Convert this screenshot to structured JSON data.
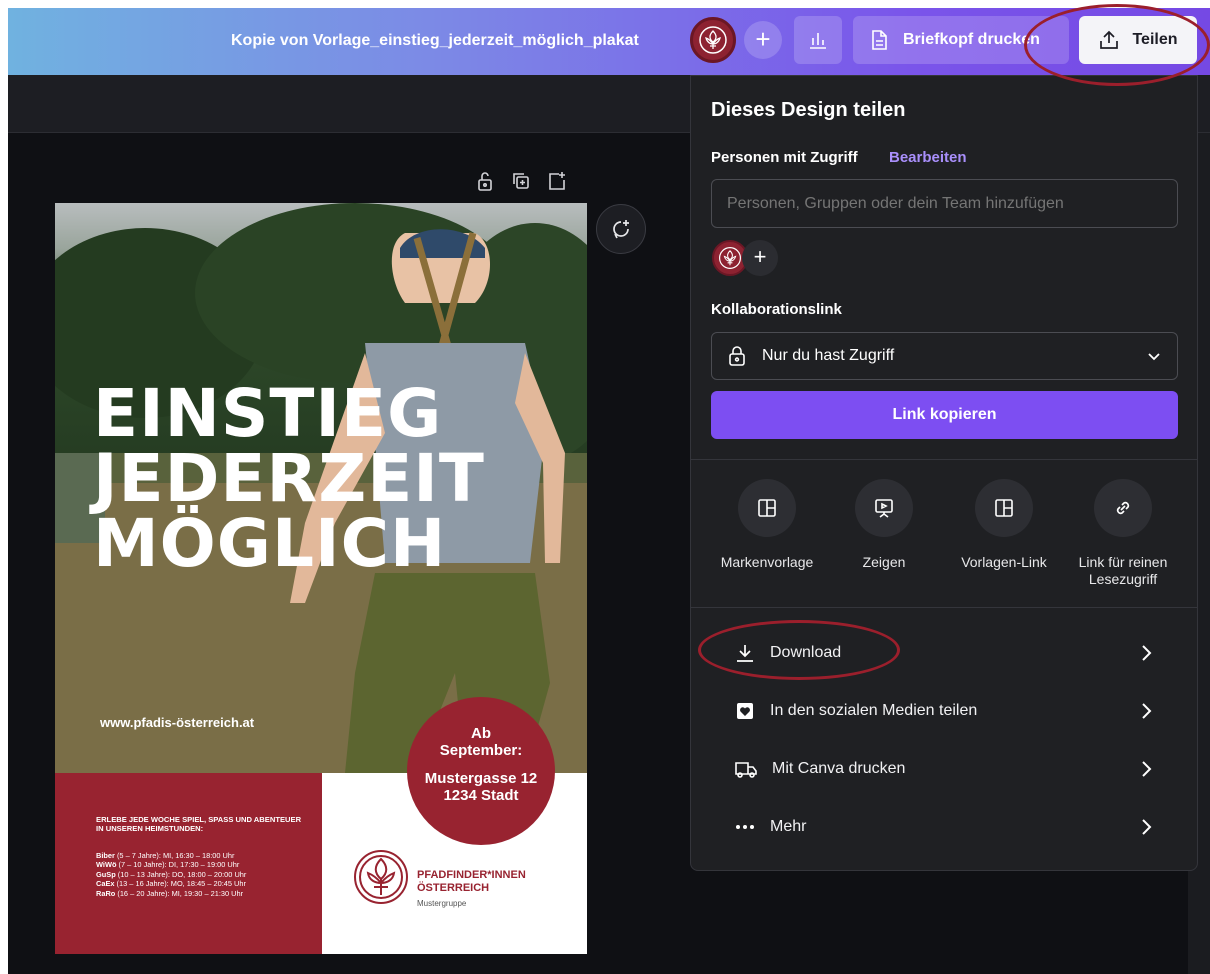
{
  "topbar": {
    "doc_title": "Kopie von Vorlage_einstieg_jederzeit_möglich_plakat",
    "print_label": "Briefkopf drucken",
    "share_label": "Teilen",
    "plus": "+"
  },
  "poster": {
    "headline": [
      "EINSTIEG",
      "JEDERZEIT",
      "MÖGLICH"
    ],
    "url": "www.pfadis-österreich.at",
    "intro": "ERLEBE JEDE WOCHE SPIEL, SPASS UND ABENTEUER IN UNSEREN HEIMSTUNDEN:",
    "schedule": [
      {
        "group": "Biber",
        "text": " (5 – 7 Jahre): MI, 16:30 – 18:00 Uhr"
      },
      {
        "group": "WiWö",
        "text": " (7 – 10 Jahre): DI, 17:30 – 19:00 Uhr"
      },
      {
        "group": "GuSp",
        "text": " (10 – 13 Jahre): DO, 18:00 – 20:00 Uhr"
      },
      {
        "group": "CaEx",
        "text": " (13 – 16 Jahre): MO, 18:45 – 20:45 Uhr"
      },
      {
        "group": "RaRo",
        "text": " (16 – 20 Jahre): MI, 19:30 – 21:30 Uhr"
      }
    ],
    "date_line1": "Ab",
    "date_line2": "September:",
    "address_line1": "Mustergasse 12",
    "address_line2": "1234 Stadt",
    "org_line1": "PFADFINDER*INNEN",
    "org_line2": "ÖSTERREICH",
    "org_sub": "Mustergruppe"
  },
  "share_panel": {
    "title": "Dieses Design teilen",
    "access_label": "Personen mit Zugriff",
    "edit_link": "Bearbeiten",
    "input_placeholder": "Personen, Gruppen oder dein Team hinzufügen",
    "collab_label": "Kollaborationslink",
    "access_value": "Nur du hast Zugriff",
    "copy_button": "Link kopieren",
    "options": [
      {
        "label": "Markenvorlage",
        "icon": "layout-icon"
      },
      {
        "label": "Zeigen",
        "icon": "present-icon"
      },
      {
        "label": "Vorlagen-Link",
        "icon": "layout-icon"
      },
      {
        "label": "Link für reinen Lesezugriff",
        "icon": "link-icon"
      }
    ],
    "rows": [
      {
        "label": "Download",
        "icon": "download-icon"
      },
      {
        "label": "In den sozialen Medien teilen",
        "icon": "heart-icon"
      },
      {
        "label": "Mit Canva drucken",
        "icon": "truck-icon"
      },
      {
        "label": "Mehr",
        "icon": "more-icon"
      }
    ]
  },
  "colors": {
    "accent_purple": "#7d4ef2",
    "brand_red": "#982330",
    "annotation_red": "#9b1f2c",
    "panel_bg": "#1f2023"
  }
}
